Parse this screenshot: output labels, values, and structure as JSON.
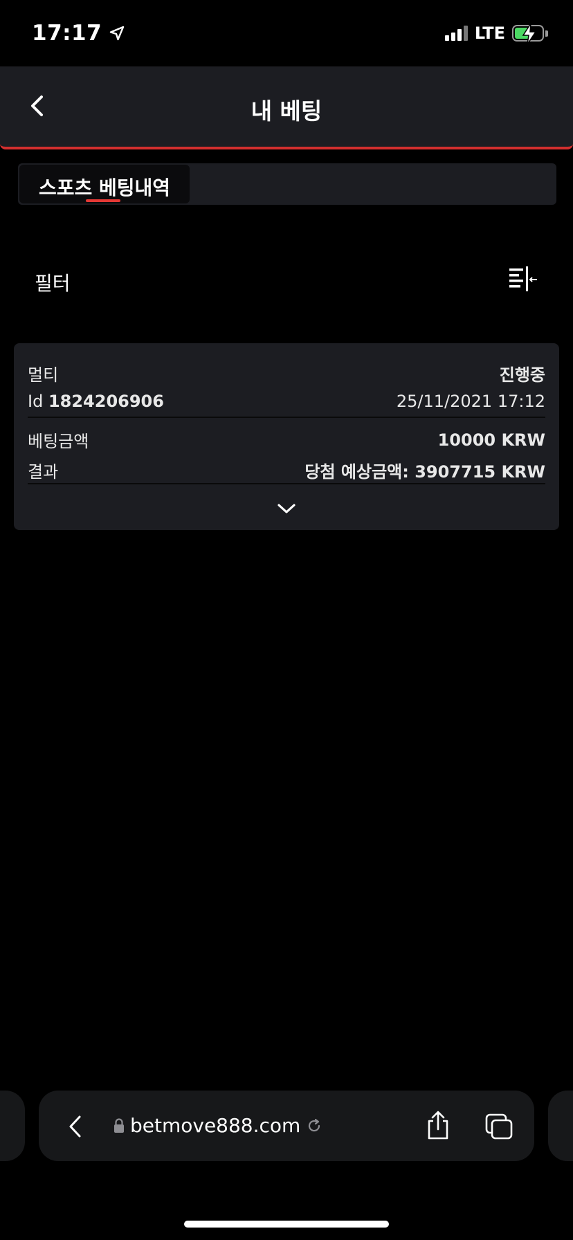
{
  "status_bar": {
    "time": "17:17",
    "network": "LTE",
    "battery_level": 0.56,
    "battery_color": "#4cd964"
  },
  "header": {
    "title": "내 베팅",
    "back_icon": "chevron-left-icon",
    "accent_color": "#d32f2f"
  },
  "tabs": [
    {
      "label": "스포츠 베팅내역",
      "active": true
    }
  ],
  "filter": {
    "label": "필터",
    "icon": "filter-collapse-icon"
  },
  "bet_card": {
    "type_label": "멀티",
    "status": "진행중",
    "id_label": "Id",
    "id_value": "1824206906",
    "date": "25/11/2021 17:12",
    "stake_label": "베팅금액",
    "stake_value": "10000 KRW",
    "result_label": "결과",
    "result_value": "당첨 예상금액: 3907715 KRW",
    "expand_icon": "chevron-down-icon"
  },
  "browser": {
    "url": "betmove888.com",
    "lock_icon": "lock-icon",
    "reload_icon": "reload-icon",
    "back_icon": "chevron-left-icon",
    "share_icon": "share-icon",
    "tabs_icon": "tabs-icon"
  }
}
